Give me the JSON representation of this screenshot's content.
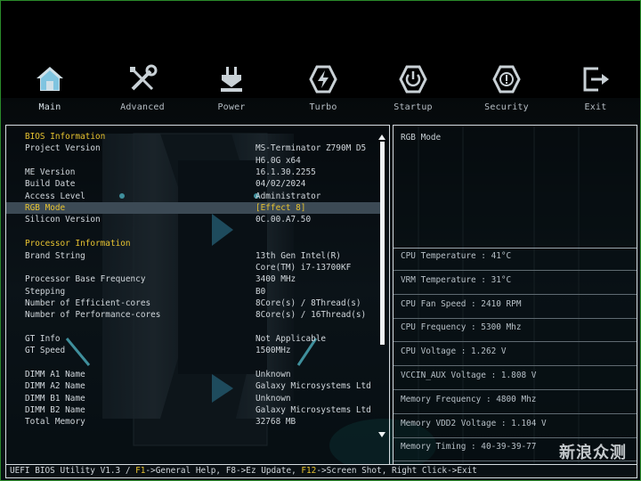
{
  "nav": [
    {
      "label": "Main",
      "icon": "home-icon"
    },
    {
      "label": "Advanced",
      "icon": "tools-icon"
    },
    {
      "label": "Power",
      "icon": "power-plug-icon"
    },
    {
      "label": "Turbo",
      "icon": "turbo-bolt-icon"
    },
    {
      "label": "Startup",
      "icon": "power-button-icon"
    },
    {
      "label": "Security",
      "icon": "shield-icon"
    },
    {
      "label": "Exit",
      "icon": "exit-icon"
    }
  ],
  "main": {
    "rows": [
      {
        "label": "BIOS Information",
        "value": "",
        "type": "section"
      },
      {
        "label": "Project Version",
        "value": "MS-Terminator Z790M D5"
      },
      {
        "label": "",
        "value": "H6.0G x64"
      },
      {
        "label": "ME Version",
        "value": "16.1.30.2255"
      },
      {
        "label": "Build Date",
        "value": "04/02/2024"
      },
      {
        "label": "Access Level",
        "value": "Administrator"
      },
      {
        "label": "RGB Mode",
        "value": "[Effect 8]",
        "type": "highlight"
      },
      {
        "label": "Silicon Version",
        "value": "0C.00.A7.50"
      },
      {
        "label": "",
        "value": ""
      },
      {
        "label": "Processor Information",
        "value": "",
        "type": "section"
      },
      {
        "label": "Brand String",
        "value": "13th Gen Intel(R)"
      },
      {
        "label": "",
        "value": "Core(TM) i7-13700KF"
      },
      {
        "label": "Processor Base Frequency",
        "value": "3400 MHz"
      },
      {
        "label": "Stepping",
        "value": "B0"
      },
      {
        "label": "Number of Efficient-cores",
        "value": "8Core(s) / 8Thread(s)"
      },
      {
        "label": "Number of Performance-cores",
        "value": "8Core(s) / 16Thread(s)"
      },
      {
        "label": "",
        "value": ""
      },
      {
        "label": "GT Info",
        "value": "Not Applicable"
      },
      {
        "label": "GT Speed",
        "value": "1500MHz"
      },
      {
        "label": "",
        "value": ""
      },
      {
        "label": "DIMM A1 Name",
        "value": "Unknown"
      },
      {
        "label": "DIMM A2 Name",
        "value": "Galaxy Microsystems Ltd"
      },
      {
        "label": "DIMM B1 Name",
        "value": "Unknown"
      },
      {
        "label": "DIMM B2 Name",
        "value": "Galaxy Microsystems Ltd"
      },
      {
        "label": "Total Memory",
        "value": "32768 MB"
      }
    ]
  },
  "help": {
    "title": "RGB Mode",
    "hw": [
      "CPU Temperature : 41°C",
      "VRM Temperature : 31°C",
      "CPU Fan Speed : 2410 RPM",
      "CPU Frequency : 5300 Mhz",
      "CPU Voltage : 1.262 V",
      "VCCIN_AUX Voltage : 1.808 V",
      "Memory Frequency : 4800 Mhz",
      "Memory VDD2 Voltage : 1.104 V",
      "Memory Timing : 40-39-39-77"
    ]
  },
  "status": {
    "prefix": "UEFI BIOS Utility V1.3 / ",
    "f1": "F1",
    "f1_text": "->General Help, ",
    "f8": "F8->Ez Update, ",
    "f12": "F12",
    "f12_text": "->Screen Shot, Right Click->Exit"
  },
  "watermark": {
    "text": "新浪众测",
    "sub": "新浪"
  },
  "colors": {
    "accent": "#e6c230",
    "highlight_bg": "#3c4a55",
    "border": "#d7dde2"
  }
}
